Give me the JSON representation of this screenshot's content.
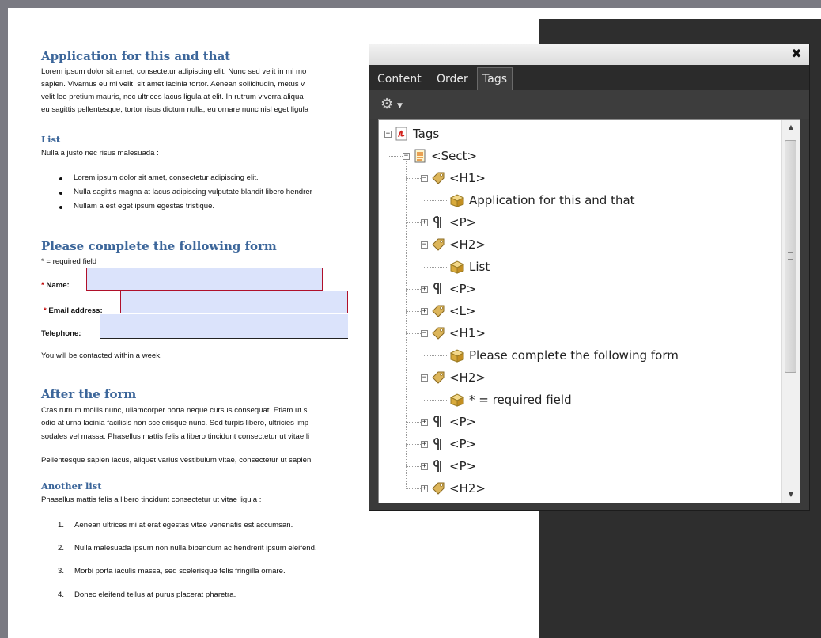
{
  "document": {
    "h1_title": "Application for this and that",
    "intro_lines": [
      "Lorem ipsum dolor sit amet, consectetur adipiscing elit. Nunc sed velit in mi mo",
      "sapien. Vivamus eu mi velit, sit amet lacinia tortor. Aenean sollicitudin, metus v",
      "velit leo pretium mauris, nec ultrices lacus ligula at elit. In rutrum viverra aliqua",
      "eu sagittis pellentesque, tortor risus dictum nulla, eu ornare nunc nisl eget ligula"
    ],
    "list_heading": "List",
    "list_intro": "Nulla a justo nec risus malesuada :",
    "bullets": [
      "Lorem ipsum dolor sit amet, consectetur adipiscing elit.",
      "Nulla sagittis magna at lacus adipiscing vulputate blandit libero hendrer",
      "Nullam a est eget ipsum egestas tristique."
    ],
    "form_heading": "Please complete the following form",
    "required_note": "* = required field",
    "fields": {
      "star": "*",
      "name_label": "Name:",
      "email_label": "Email address:",
      "phone_label": "Telephone:"
    },
    "contact_note": "You will be contacted within a week.",
    "after_heading": "After the form",
    "after_lines": [
      "Cras rutrum mollis nunc, ullamcorper porta neque cursus consequat. Etiam ut s",
      "odio at urna lacinia facilisis non scelerisque nunc. Sed turpis libero, ultricies imp",
      "sodales vel massa. Phasellus mattis felis a libero tincidunt consectetur ut vitae li"
    ],
    "pellentesque_line": "Pellentesque sapien lacus, aliquet varius vestibulum vitae, consectetur ut sapien",
    "another_list_heading": "Another list",
    "another_list_intro": "Phasellus mattis felis a libero tincidunt consectetur ut vitae ligula :",
    "numbers": [
      "1.",
      "2.",
      "3.",
      "4."
    ],
    "numbered": [
      "Aenean ultrices mi at erat egestas vitae venenatis est accumsan.",
      "Nulla malesuada ipsum non nulla bibendum ac hendrerit ipsum eleifend.",
      "Morbi porta iaculis massa, sed scelerisque felis fringilla ornare.",
      "Donec eleifend tellus at purus placerat pharetra."
    ]
  },
  "panel": {
    "close_symbol": "✖",
    "tabs": [
      "Content",
      "Order",
      "Tags"
    ],
    "active_tab": "Tags",
    "gear_icon": "gear-icon",
    "tree": [
      {
        "label": "Tags",
        "icon": "pdf-icon",
        "expander": "−"
      },
      {
        "label": "<Sect>",
        "icon": "section-icon",
        "expander": "−"
      },
      {
        "label": "<H1>",
        "icon": "tag-icon",
        "expander": "−"
      },
      {
        "label": "Application for this and that",
        "icon": "content-box-icon",
        "expander": ""
      },
      {
        "label": "<P>",
        "icon": "paragraph-icon",
        "expander": "+"
      },
      {
        "label": "<H2>",
        "icon": "tag-icon",
        "expander": "−"
      },
      {
        "label": "List",
        "icon": "content-box-icon",
        "expander": ""
      },
      {
        "label": "<P>",
        "icon": "paragraph-icon",
        "expander": "+"
      },
      {
        "label": "<L>",
        "icon": "tag-icon",
        "expander": "+"
      },
      {
        "label": "<H1>",
        "icon": "tag-icon",
        "expander": "−"
      },
      {
        "label": "Please complete the following form",
        "icon": "content-box-icon",
        "expander": ""
      },
      {
        "label": "<H2>",
        "icon": "tag-icon",
        "expander": "−"
      },
      {
        "label": "* = required field",
        "icon": "content-box-icon",
        "expander": ""
      },
      {
        "label": "<P>",
        "icon": "paragraph-icon",
        "expander": "+"
      },
      {
        "label": "<P>",
        "icon": "paragraph-icon",
        "expander": "+"
      },
      {
        "label": "<P>",
        "icon": "paragraph-icon",
        "expander": "+"
      },
      {
        "label": "<H2>",
        "icon": "tag-icon",
        "expander": "+"
      }
    ],
    "scroll_arrows": {
      "up": "▲",
      "down": "▼"
    }
  },
  "colors": {
    "heading": "#3c669a",
    "required_star": "#c00000",
    "field_fill": "#dbe3fb",
    "field_border": "#b0102a"
  }
}
